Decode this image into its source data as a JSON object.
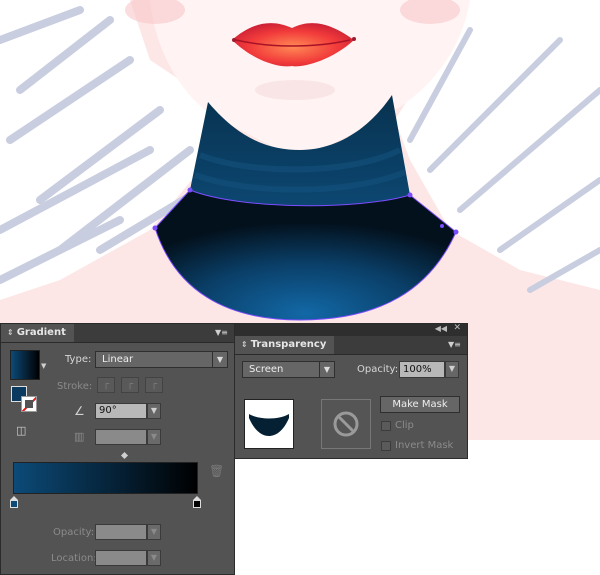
{
  "gradient_panel": {
    "tab_label": "Gradient",
    "type_label": "Type:",
    "type_value": "Linear",
    "stroke_label": "Stroke:",
    "angle_value": "90°",
    "opacity_label": "Opacity:",
    "location_label": "Location:",
    "gradient_colors": [
      "#0c4a78",
      "#000000"
    ]
  },
  "transparency_panel": {
    "tab_label": "Transparency",
    "blend_mode": "Screen",
    "opacity_label": "Opacity:",
    "opacity_value": "100%",
    "make_mask_label": "Make Mask",
    "clip_label": "Clip",
    "invert_mask_label": "Invert Mask"
  },
  "icons": [
    "menu-icon",
    "trash-icon",
    "no-sign-icon",
    "gradient-swatch-icon",
    "angle-icon",
    "aspect-ratio-icon",
    "reverse-gradient-icon"
  ]
}
